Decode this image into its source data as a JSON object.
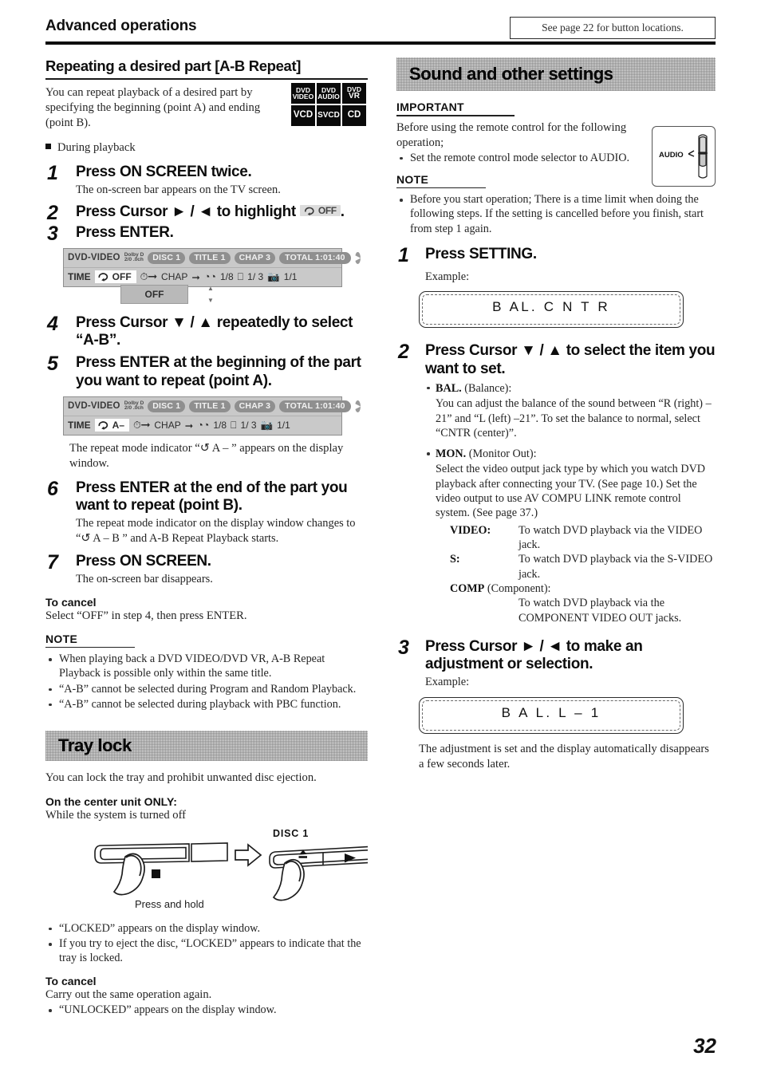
{
  "running_head": {
    "title": "Advanced operations",
    "see_page_note": "See page 22 for button locations."
  },
  "page_number": "32",
  "left_column": {
    "section_ab_repeat": {
      "heading": "Repeating a desired part [A-B Repeat]",
      "intro": "You can repeat playback of a desired part by specifying the beginning (point A) and ending (point B).",
      "disc_badges": [
        {
          "line1": "DVD",
          "line2": "VIDEO"
        },
        {
          "line1": "DVD",
          "line2": "AUDIO"
        },
        {
          "line1": "DVD",
          "line2": "VR"
        },
        {
          "line1": "VCD",
          "line2": ""
        },
        {
          "line1": "SVCD",
          "line2": ""
        },
        {
          "line1": "CD",
          "line2": ""
        }
      ],
      "during_playback": "During playback",
      "steps": [
        {
          "num": "1",
          "title": "Press ON SCREEN twice.",
          "desc": "The on-screen bar appears on the TV screen."
        },
        {
          "num": "2",
          "title_pre": "Press Cursor ► / ◄ to highlight",
          "title_post": ".",
          "chip": "OFF"
        },
        {
          "num": "3",
          "title": "Press ENTER."
        },
        {
          "num": "4",
          "title": "Press Cursor ▼ / ▲ repeatedly to select “A-B”."
        },
        {
          "num": "5",
          "title": "Press ENTER at the beginning of the part you want to repeat (point A).",
          "desc": "The repeat mode indicator “↺ A – ” appears on the display window."
        },
        {
          "num": "6",
          "title": "Press ENTER at the end of the part you want to repeat (point B).",
          "desc": "The repeat mode indicator on the display window changes to “↺ A – B ” and A-B Repeat Playback starts."
        },
        {
          "num": "7",
          "title": "Press ON SCREEN.",
          "desc": "The on-screen bar disappears."
        }
      ],
      "osb1": {
        "disc_type": "DVD-VIDEO",
        "dolby_line1": "Dolby D",
        "dolby_line2": "2/0  .0ch",
        "chips": [
          "DISC 1",
          "TITLE  1",
          "CHAP  3",
          "TOTAL   1:01:40"
        ],
        "row2_label": "TIME",
        "repeat_value": "OFF",
        "chap_label": "CHAP",
        "audio_value": "1/8",
        "subtitle_value": "1/ 3",
        "angle_value": "1/1",
        "pulldown_value": "OFF"
      },
      "osb2": {
        "disc_type": "DVD-VIDEO",
        "dolby_line1": "Dolby D",
        "dolby_line2": "2/0  .0ch",
        "chips": [
          "DISC 1",
          "TITLE  1",
          "CHAP  3",
          "TOTAL   1:01:40"
        ],
        "row2_label": "TIME",
        "repeat_value": "A–",
        "chap_label": "CHAP",
        "audio_value": "1/8",
        "subtitle_value": "1/ 3",
        "angle_value": "1/1"
      },
      "to_cancel_heading": "To cancel",
      "to_cancel_text": "Select “OFF” in step 4, then press ENTER.",
      "note_heading": "NOTE",
      "notes": [
        "When playing back a DVD VIDEO/DVD VR, A-B Repeat Playback is possible only within the same title.",
        "“A-B” cannot be selected during Program and Random Playback.",
        "“A-B” cannot be selected during playback with PBC function."
      ]
    },
    "section_tray_lock": {
      "heading": "Tray lock",
      "intro": "You can lock the tray and prohibit unwanted disc ejection.",
      "subheading": "On the center unit ONLY:",
      "sub_text": "While the system is turned off",
      "illustration": {
        "caption": "Press and hold",
        "disc_label": "DISC  1"
      },
      "bullets": [
        "“LOCKED” appears on the display window.",
        "If you try to eject the disc, “LOCKED” appears to indicate that the tray is locked."
      ],
      "to_cancel_heading": "To cancel",
      "to_cancel_text": "Carry out the same operation again.",
      "to_cancel_bullets": [
        "“UNLOCKED” appears on the display window."
      ]
    }
  },
  "right_column": {
    "section_sound": {
      "heading": "Sound and other settings",
      "important_heading": "IMPORTANT",
      "important_text": "Before using the remote control for the following operation;",
      "important_bullets": [
        "Set the remote control mode selector to AUDIO."
      ],
      "audio_box_label": "AUDIO",
      "note_heading": "NOTE",
      "notes": [
        "Before you start operation; There is a time limit when doing the following steps. If the setting is cancelled before you finish, start from step 1 again."
      ],
      "steps": [
        {
          "num": "1",
          "title": "Press SETTING.",
          "example_label": "Example:",
          "display": "B AL.    C N T R"
        },
        {
          "num": "2",
          "title": "Press Cursor ▼ / ▲ to select the item you want to set.",
          "items": [
            {
              "key": "BAL.",
              "key_note": "(Balance):",
              "text": "You can adjust the balance of the sound between “R (right) – 21” and “L (left) –21”. To set the balance to normal, select “CNTR (center)”."
            },
            {
              "key": "MON.",
              "key_note": "(Monitor Out):",
              "text": "Select the video output jack type by which you watch DVD playback after connecting your TV. (See page 10.) Set the video output to use AV COMPU LINK remote control system. (See page 37.)",
              "table": [
                {
                  "label": "VIDEO:",
                  "value": "To watch DVD playback via the VIDEO jack."
                },
                {
                  "label": "S:",
                  "value": "To watch DVD playback via the S-VIDEO jack."
                },
                {
                  "label": "COMP",
                  "label_note": "(Component):",
                  "value": "To watch DVD playback via the COMPONENT VIDEO OUT jacks."
                }
              ]
            }
          ]
        },
        {
          "num": "3",
          "title": "Press Cursor ► / ◄ to make an adjustment or selection.",
          "example_label": "Example:",
          "display": "B A L.    L      – 1",
          "desc": "The adjustment is set and the display automatically disappears a few seconds later."
        }
      ]
    }
  }
}
